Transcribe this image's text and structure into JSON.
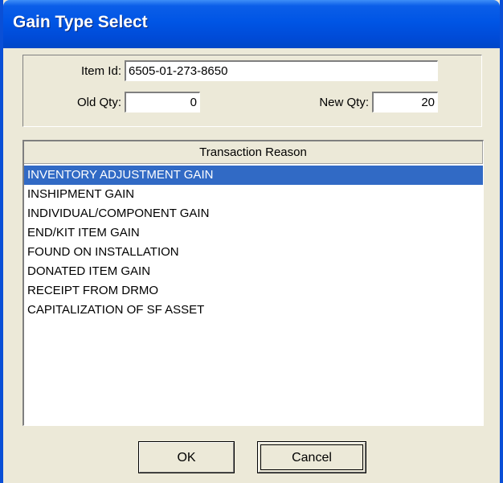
{
  "window": {
    "title": "Gain Type Select"
  },
  "form": {
    "item_id_label": "Item Id:",
    "item_id_value": "6505-01-273-8650",
    "old_qty_label": "Old Qty:",
    "old_qty_value": "0",
    "new_qty_label": "New Qty:",
    "new_qty_value": "20"
  },
  "list": {
    "header": "Transaction Reason",
    "items": [
      "INVENTORY ADJUSTMENT GAIN",
      "INSHIPMENT GAIN",
      "INDIVIDUAL/COMPONENT GAIN",
      "END/KIT ITEM GAIN",
      "FOUND ON INSTALLATION",
      "DONATED ITEM GAIN",
      "RECEIPT FROM DRMO",
      "CAPITALIZATION OF SF ASSET"
    ],
    "selected_index": 0
  },
  "buttons": {
    "ok": "OK",
    "cancel": "Cancel"
  },
  "colors": {
    "titlebar": "#0055e5",
    "selection": "#316ac5",
    "dialog_bg": "#ece9d8"
  }
}
